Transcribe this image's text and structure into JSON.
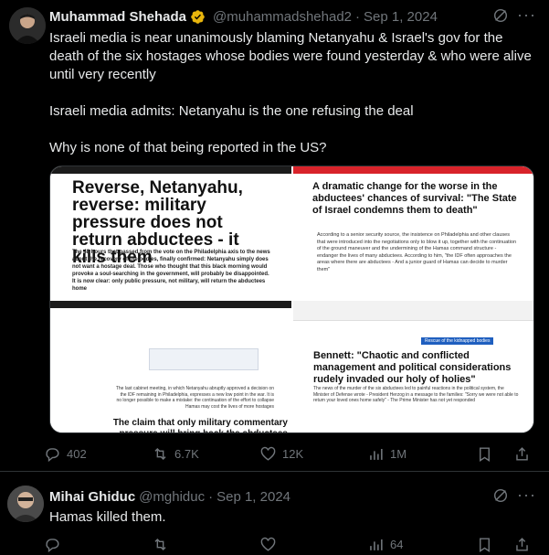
{
  "tweet1": {
    "author_name": "Muhammad Shehada",
    "handle": "@muhammadshehad2",
    "separator": "·",
    "date": "Sep 1, 2024",
    "text": "Israeli media is near unanimously blaming Netanyahu & Israel's gov for the death of the six hostages whose bodies were found yesterday & who were alive until very recently\n\nIsraeli media admits: Netanyahu is the one refusing the deal\n\nWhy is none of that being reported in the US?",
    "media": {
      "panel1": {
        "headline": "Reverse, Netanyahu, reverse: military pressure does not return abductees - it kills them",
        "sub": "The 48 hours that passed from the vote on the Philadelphia axis to the news about the recovery of the bodies, finally confirmed: Netanyahu simply does not want a hostage deal. Those who thought that this black morning would provoke a soul-searching in the government, will probably be disappointed. It is now clear: only public pressure, not military, will return the abductees home"
      },
      "panel2": {
        "headline": "A dramatic change for the worse in the abductees' chances of survival: \"The State of Israel condemns them to death\"",
        "sub": "According to a senior security source, the insistence on Philadelphia and other clauses that were introduced into the negotiations only to blow it up, together with the continuation of the ground maneuver and the undermining of the Hamas command structure - endanger the lives of many abductees. According to him, \"the IDF often approaches the areas where there are abductees - And a junior guard of Hamas can decide to murder them\""
      },
      "panel3": {
        "headline": "The claim that only military commentary pressure will bring back the abductees was never true. Now she is unfounded",
        "sub": "The last cabinet meeting, in which Netanyahu abruptly approved a decision on the IDF remaining in Philadelphia, expresses a new low point in the war. It is no longer possible to make a mistake: the continuation of the effort to collapse Hamas may cost the lives of more hostages"
      },
      "panel4": {
        "tag": "Rescue of the kidnapped bodies",
        "headline": "Bennett: \"Chaotic and conflicted management and political considerations rudely invaded our holy of holies\"",
        "sub": "The news of the murder of the six abductees led to painful reactions in the political system, the Minister of Defense wrote - President Herzog in a message to the families: \"Sorry we were not able to return your loved ones home safely\" - The Prime Minister has not yet responded"
      }
    },
    "stats": {
      "replies": "402",
      "reposts": "6.7K",
      "likes": "12K",
      "views": "1M"
    }
  },
  "tweet2": {
    "author_name": "Mihai Ghiduc",
    "handle": "@mghiduc",
    "separator": "·",
    "date": "Sep 1, 2024",
    "text": "Hamas killed them.",
    "stats": {
      "replies": "",
      "reposts": "",
      "likes": "",
      "views": "64"
    }
  },
  "colors": {
    "background": "#000000",
    "text": "#e7e9ea",
    "muted": "#71767b",
    "border": "#2f3336",
    "verified": "#f4c430"
  },
  "icons": [
    "verified-gold-icon",
    "grok-icon",
    "more-icon",
    "reply-icon",
    "repost-icon",
    "like-icon",
    "views-icon",
    "bookmark-icon",
    "share-icon"
  ]
}
